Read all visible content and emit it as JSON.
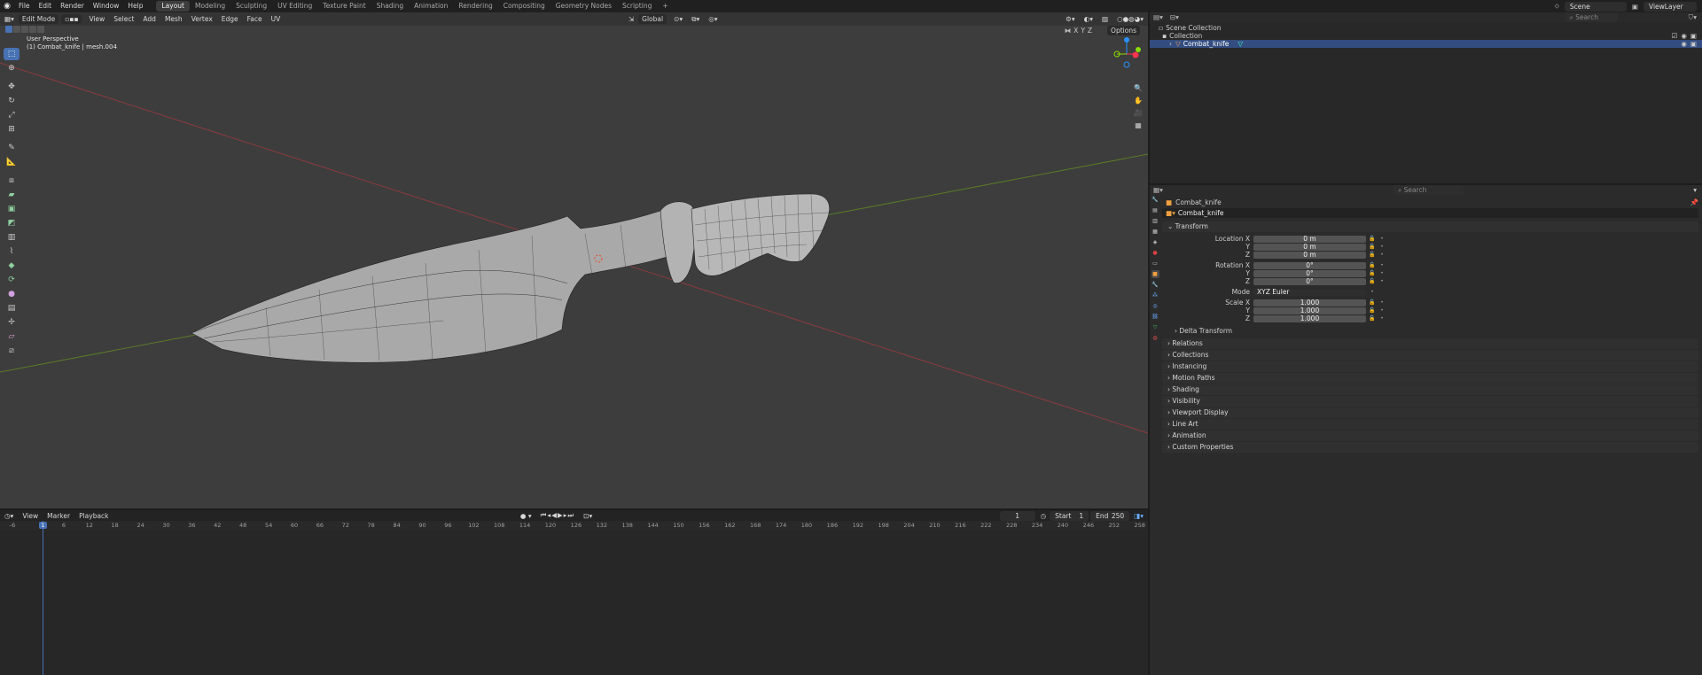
{
  "topbar": {
    "menus": [
      "File",
      "Edit",
      "Render",
      "Window",
      "Help"
    ],
    "workspaces": [
      "Layout",
      "Modeling",
      "Sculpting",
      "UV Editing",
      "Texture Paint",
      "Shading",
      "Animation",
      "Rendering",
      "Compositing",
      "Geometry Nodes",
      "Scripting"
    ],
    "active_workspace": "Layout",
    "add_tab_icon": "+",
    "scene": "Scene",
    "view_layer": "ViewLayer"
  },
  "viewport": {
    "mode": "Edit Mode",
    "menus": [
      "View",
      "Select",
      "Add",
      "Mesh",
      "Vertex",
      "Edge",
      "Face",
      "UV"
    ],
    "transform_orientation": "Global",
    "options_label": "Options",
    "axis_toggles": [
      "X",
      "Y",
      "Z"
    ],
    "info_line1": "User Perspective",
    "info_line2": "(1) Combat_knife | mesh.004",
    "gizmo_colors": {
      "x": "#ff3352",
      "y": "#8bdc00",
      "z": "#2890ff"
    },
    "toolbar_icons": [
      "select-box-icon",
      "cursor-icon",
      "move-icon",
      "rotate-icon",
      "scale-icon",
      "transform-icon",
      "annotate-icon",
      "measure-icon",
      "add-cube-icon",
      "extrude-icon",
      "inset-icon",
      "bevel-icon",
      "loop-cut-icon",
      "knife-icon",
      "poly-build-icon",
      "spin-icon",
      "smooth-icon",
      "edge-slide-icon",
      "shrink-fatten-icon",
      "shear-icon",
      "rip-icon"
    ],
    "nav_icons": [
      "zoom-icon",
      "hand-pan-icon",
      "camera-view-icon",
      "grid-view-icon"
    ]
  },
  "outliner": {
    "search_placeholder": "Search",
    "rows": [
      "Scene Collection",
      "Collection",
      "Combat_knife"
    ]
  },
  "properties": {
    "search_placeholder": "Search",
    "object_name": "Combat_knife",
    "data_name": "Combat_knife",
    "transform_label": "Transform",
    "location_label": "Location X",
    "rotation_label": "Rotation X",
    "scale_label": "Scale X",
    "axis_y": "Y",
    "axis_z": "Z",
    "location": [
      "0 m",
      "0 m",
      "0 m"
    ],
    "rotation": [
      "0°",
      "0°",
      "0°"
    ],
    "mode_label": "Mode",
    "mode_value": "XYZ Euler",
    "scale": [
      "1.000",
      "1.000",
      "1.000"
    ],
    "delta_transform": "Delta Transform",
    "panels": [
      "Relations",
      "Collections",
      "Instancing",
      "Motion Paths",
      "Shading",
      "Visibility",
      "Viewport Display",
      "Line Art",
      "Animation",
      "Custom Properties"
    ]
  },
  "timeline": {
    "menus": [
      "View",
      "Marker",
      "Playback"
    ],
    "current_frame": "1",
    "start_label": "Start",
    "start": "1",
    "end_label": "End",
    "end": "250",
    "ruler_ticks": [
      "-6",
      "1",
      "6",
      "12",
      "18",
      "24",
      "30",
      "36",
      "42",
      "48",
      "54",
      "60",
      "66",
      "72",
      "78",
      "84",
      "90",
      "96",
      "102",
      "108",
      "114",
      "120",
      "126",
      "132",
      "138",
      "144",
      "150",
      "156",
      "162",
      "168",
      "174",
      "180",
      "186",
      "192",
      "198",
      "204",
      "210",
      "216",
      "222",
      "228",
      "234",
      "240",
      "246",
      "252",
      "258"
    ],
    "playhead_frame": "1"
  }
}
